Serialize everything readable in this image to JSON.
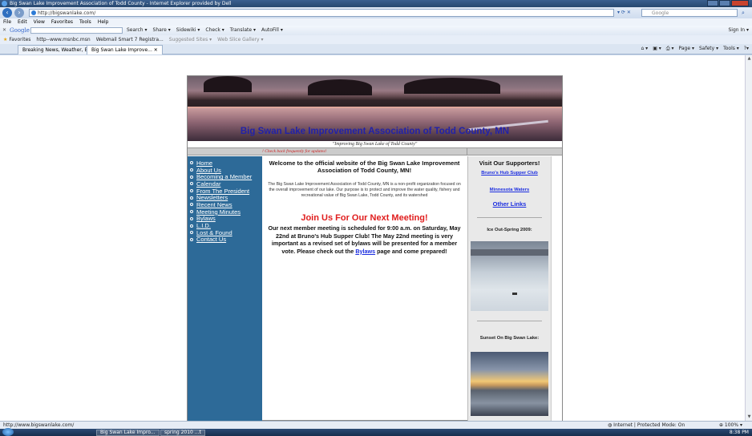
{
  "window": {
    "title": "Big Swan Lake Improvement Association of Todd County - Internet Explorer provided by Dell"
  },
  "addressbar": {
    "url": "http://bigswanlake.com/",
    "search_placeholder": "Google"
  },
  "menu": [
    "File",
    "Edit",
    "View",
    "Favorites",
    "Tools",
    "Help"
  ],
  "google_toolbar": {
    "logo": "Google",
    "tools": [
      "Search ▾",
      "Share ▾",
      "Sidewiki ▾",
      "Check ▾",
      "Translate ▾",
      "AutoFill ▾"
    ],
    "signin": "Sign In ▾"
  },
  "favorites": {
    "label": "Favorites",
    "items": [
      "http--www.msnbc.msn",
      "Webmail Smart 7 Registra...",
      "Suggested Sites ▾",
      "Web Slice Gallery ▾"
    ]
  },
  "tabs": {
    "items": [
      "Breaking News, Weather, B...",
      "Big Swan Lake Improve..."
    ],
    "commands": [
      "Page ▾",
      "Safety ▾",
      "Tools ▾"
    ]
  },
  "site": {
    "banner_title": "Big Swan Lake Improvement Association of Todd County, MN",
    "tagline": "\"Improving Big Swan Lake of Todd County\"",
    "update_msg": "! Check back frequently for updates!",
    "nav": [
      "Home",
      "About Us",
      "Becoming a Member",
      "Calendar",
      "From The President",
      "Newsletters",
      "Recent News",
      "Meeting Minutes",
      "Bylaws",
      "L.I.D.",
      "Lost & Found",
      "Contact Us"
    ],
    "welcome": "Welcome to the official website of the Big Swan Lake Improvement Association of Todd County, MN!",
    "intro": "The Big Swan Lake Improvement Association of Todd County, MN is a non-profit organization focused on the overall improvement of our lake. Our purpose is to protect and improve the water quality, fishery and recreational value of Big Swan Lake, Todd County, and its watershed",
    "join_heading": "Join Us For Our Next Meeting!",
    "meeting_pre": "Our next member meeting is scheduled for 9:00 a.m. on Saturday, May 22nd at Bruno's Hub Supper Club! The May 22nd meeting is very important as a revised set of bylaws will be presented for a member vote. Please check out the ",
    "meeting_link": "Bylaws",
    "meeting_post": " page and come prepared!",
    "supporters_heading": "Visit Our Supporters!",
    "sponsors": [
      "Bruno's Hub Supper Club",
      "Minnesota Waters"
    ],
    "other_links": "Other Links",
    "photo1_caption": "Ice Out-Spring 2009:",
    "photo2_caption": "Sunset On Big Swan Lake:"
  },
  "statusbar": {
    "url": "http://www.bigswanlake.com/",
    "zone": "Internet | Protected Mode: On",
    "zoom": "100%"
  },
  "taskbar": {
    "items": [
      "Big Swan Lake Impro...",
      "spring 2010 ...t"
    ],
    "clock": "8:38 PM"
  }
}
